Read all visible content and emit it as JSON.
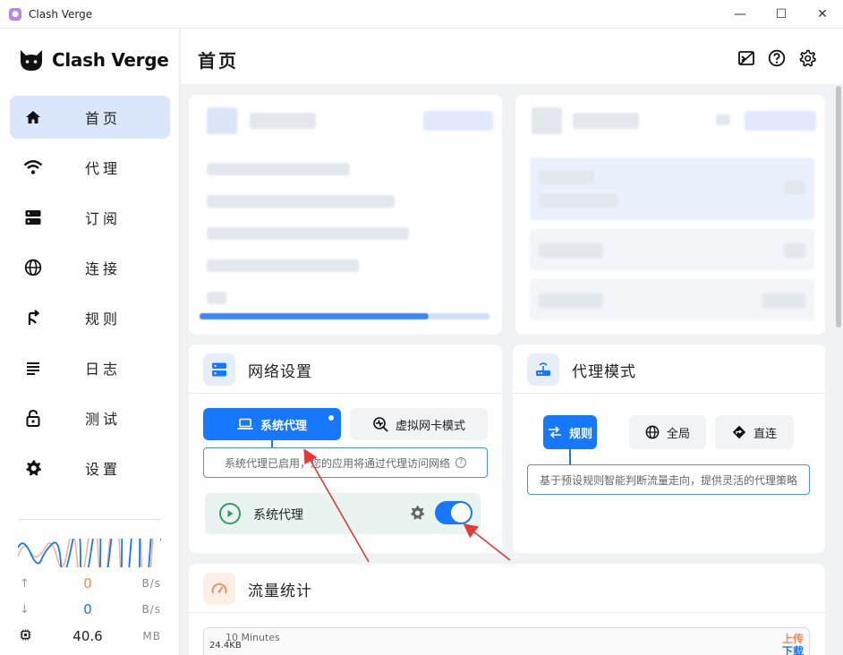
{
  "window": {
    "title": "Clash Verge",
    "minimize": "—",
    "maximize": "☐",
    "close": "✕"
  },
  "sidebar": {
    "logo_text": "Clash Verge",
    "items": [
      {
        "label": "首页",
        "icon": "home-icon",
        "active": true
      },
      {
        "label": "代理",
        "icon": "wifi-icon",
        "active": false
      },
      {
        "label": "订阅",
        "icon": "dns-icon",
        "active": false
      },
      {
        "label": "连接",
        "icon": "globe-icon",
        "active": false
      },
      {
        "label": "规则",
        "icon": "fork-icon",
        "active": false
      },
      {
        "label": "日志",
        "icon": "list-icon",
        "active": false
      },
      {
        "label": "测试",
        "icon": "lock-icon",
        "active": false
      },
      {
        "label": "设置",
        "icon": "gear-icon",
        "active": false
      }
    ],
    "traffic": {
      "upload_value": "0",
      "upload_unit": "B/s",
      "download_value": "0",
      "download_unit": "B/s",
      "memory_value": "40.6",
      "memory_unit": "MB"
    }
  },
  "header": {
    "page_title": "首页",
    "icons": [
      "terminal-icon",
      "help-icon",
      "settings-icon"
    ]
  },
  "network_card": {
    "title": "网络设置",
    "btn_system_proxy": "系统代理",
    "btn_tun": "虚拟网卡模式",
    "hint": "系统代理已启用，您的应用将通过代理访问网络",
    "row_label": "系统代理",
    "toggle_on": true
  },
  "proxy_mode_card": {
    "title": "代理模式",
    "btn_rule": "规则",
    "btn_global": "全局",
    "btn_direct": "直连",
    "hint": "基于预设规则智能判断流量走向，提供灵活的代理策略"
  },
  "traffic_card": {
    "title": "流量统计",
    "chart_window": "10 Minutes",
    "y_label": "24.4KB",
    "legend_up": "上传",
    "legend_down": "下载"
  },
  "colors": {
    "accent": "#1677ff",
    "active_nav": "#d9e6fb",
    "upload": "#f5895b",
    "download": "#1677ff",
    "green": "#2f9e5f"
  }
}
